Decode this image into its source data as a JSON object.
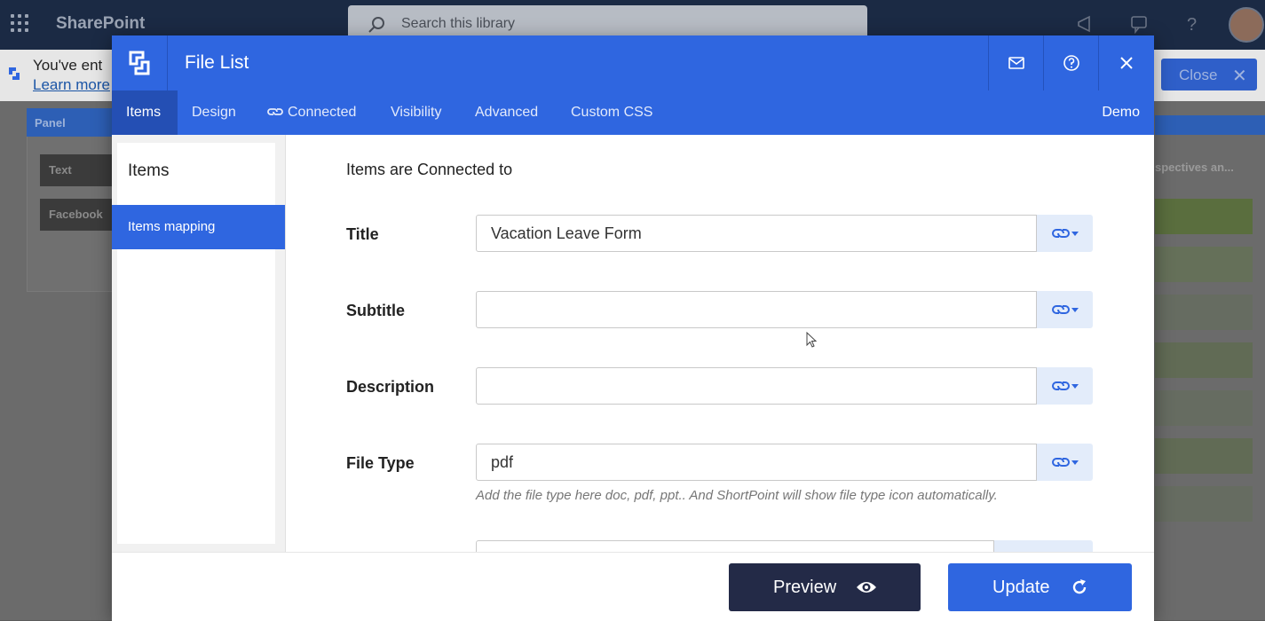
{
  "sharepoint": {
    "brand": "SharePoint",
    "search_placeholder": "Search this library",
    "message_line1": "You've ent",
    "message_link": "Learn more",
    "close_label": "Close",
    "panel_title": "Panel",
    "panel_buttons": [
      "Text",
      "Facebook"
    ],
    "right_text": "spectives an..."
  },
  "modal": {
    "title": "File List",
    "tabs": [
      {
        "label": "Items",
        "active": true
      },
      {
        "label": "Design",
        "active": false
      },
      {
        "label": "Connected",
        "active": false,
        "icon": "link-icon"
      },
      {
        "label": "Visibility",
        "active": false
      },
      {
        "label": "Advanced",
        "active": false
      },
      {
        "label": "Custom CSS",
        "active": false
      }
    ],
    "demo_label": "Demo",
    "sidebar": {
      "title": "Items",
      "items": [
        {
          "label": "Items mapping",
          "active": true
        }
      ]
    },
    "content": {
      "heading": "Items are Connected to",
      "fields": [
        {
          "label": "Title",
          "value": "Vacation Leave Form"
        },
        {
          "label": "Subtitle",
          "value": ""
        },
        {
          "label": "Description",
          "value": ""
        },
        {
          "label": "File Type",
          "value": "pdf"
        }
      ],
      "file_type_hint": "Add the file type here doc, pdf, ppt.. And ShortPoint will show file type icon automatically."
    },
    "footer": {
      "preview_label": "Preview",
      "update_label": "Update"
    }
  },
  "colors": {
    "accent": "#2f66e0",
    "dark_button": "#232a47",
    "sharepoint_bar": "#1b2a44"
  }
}
